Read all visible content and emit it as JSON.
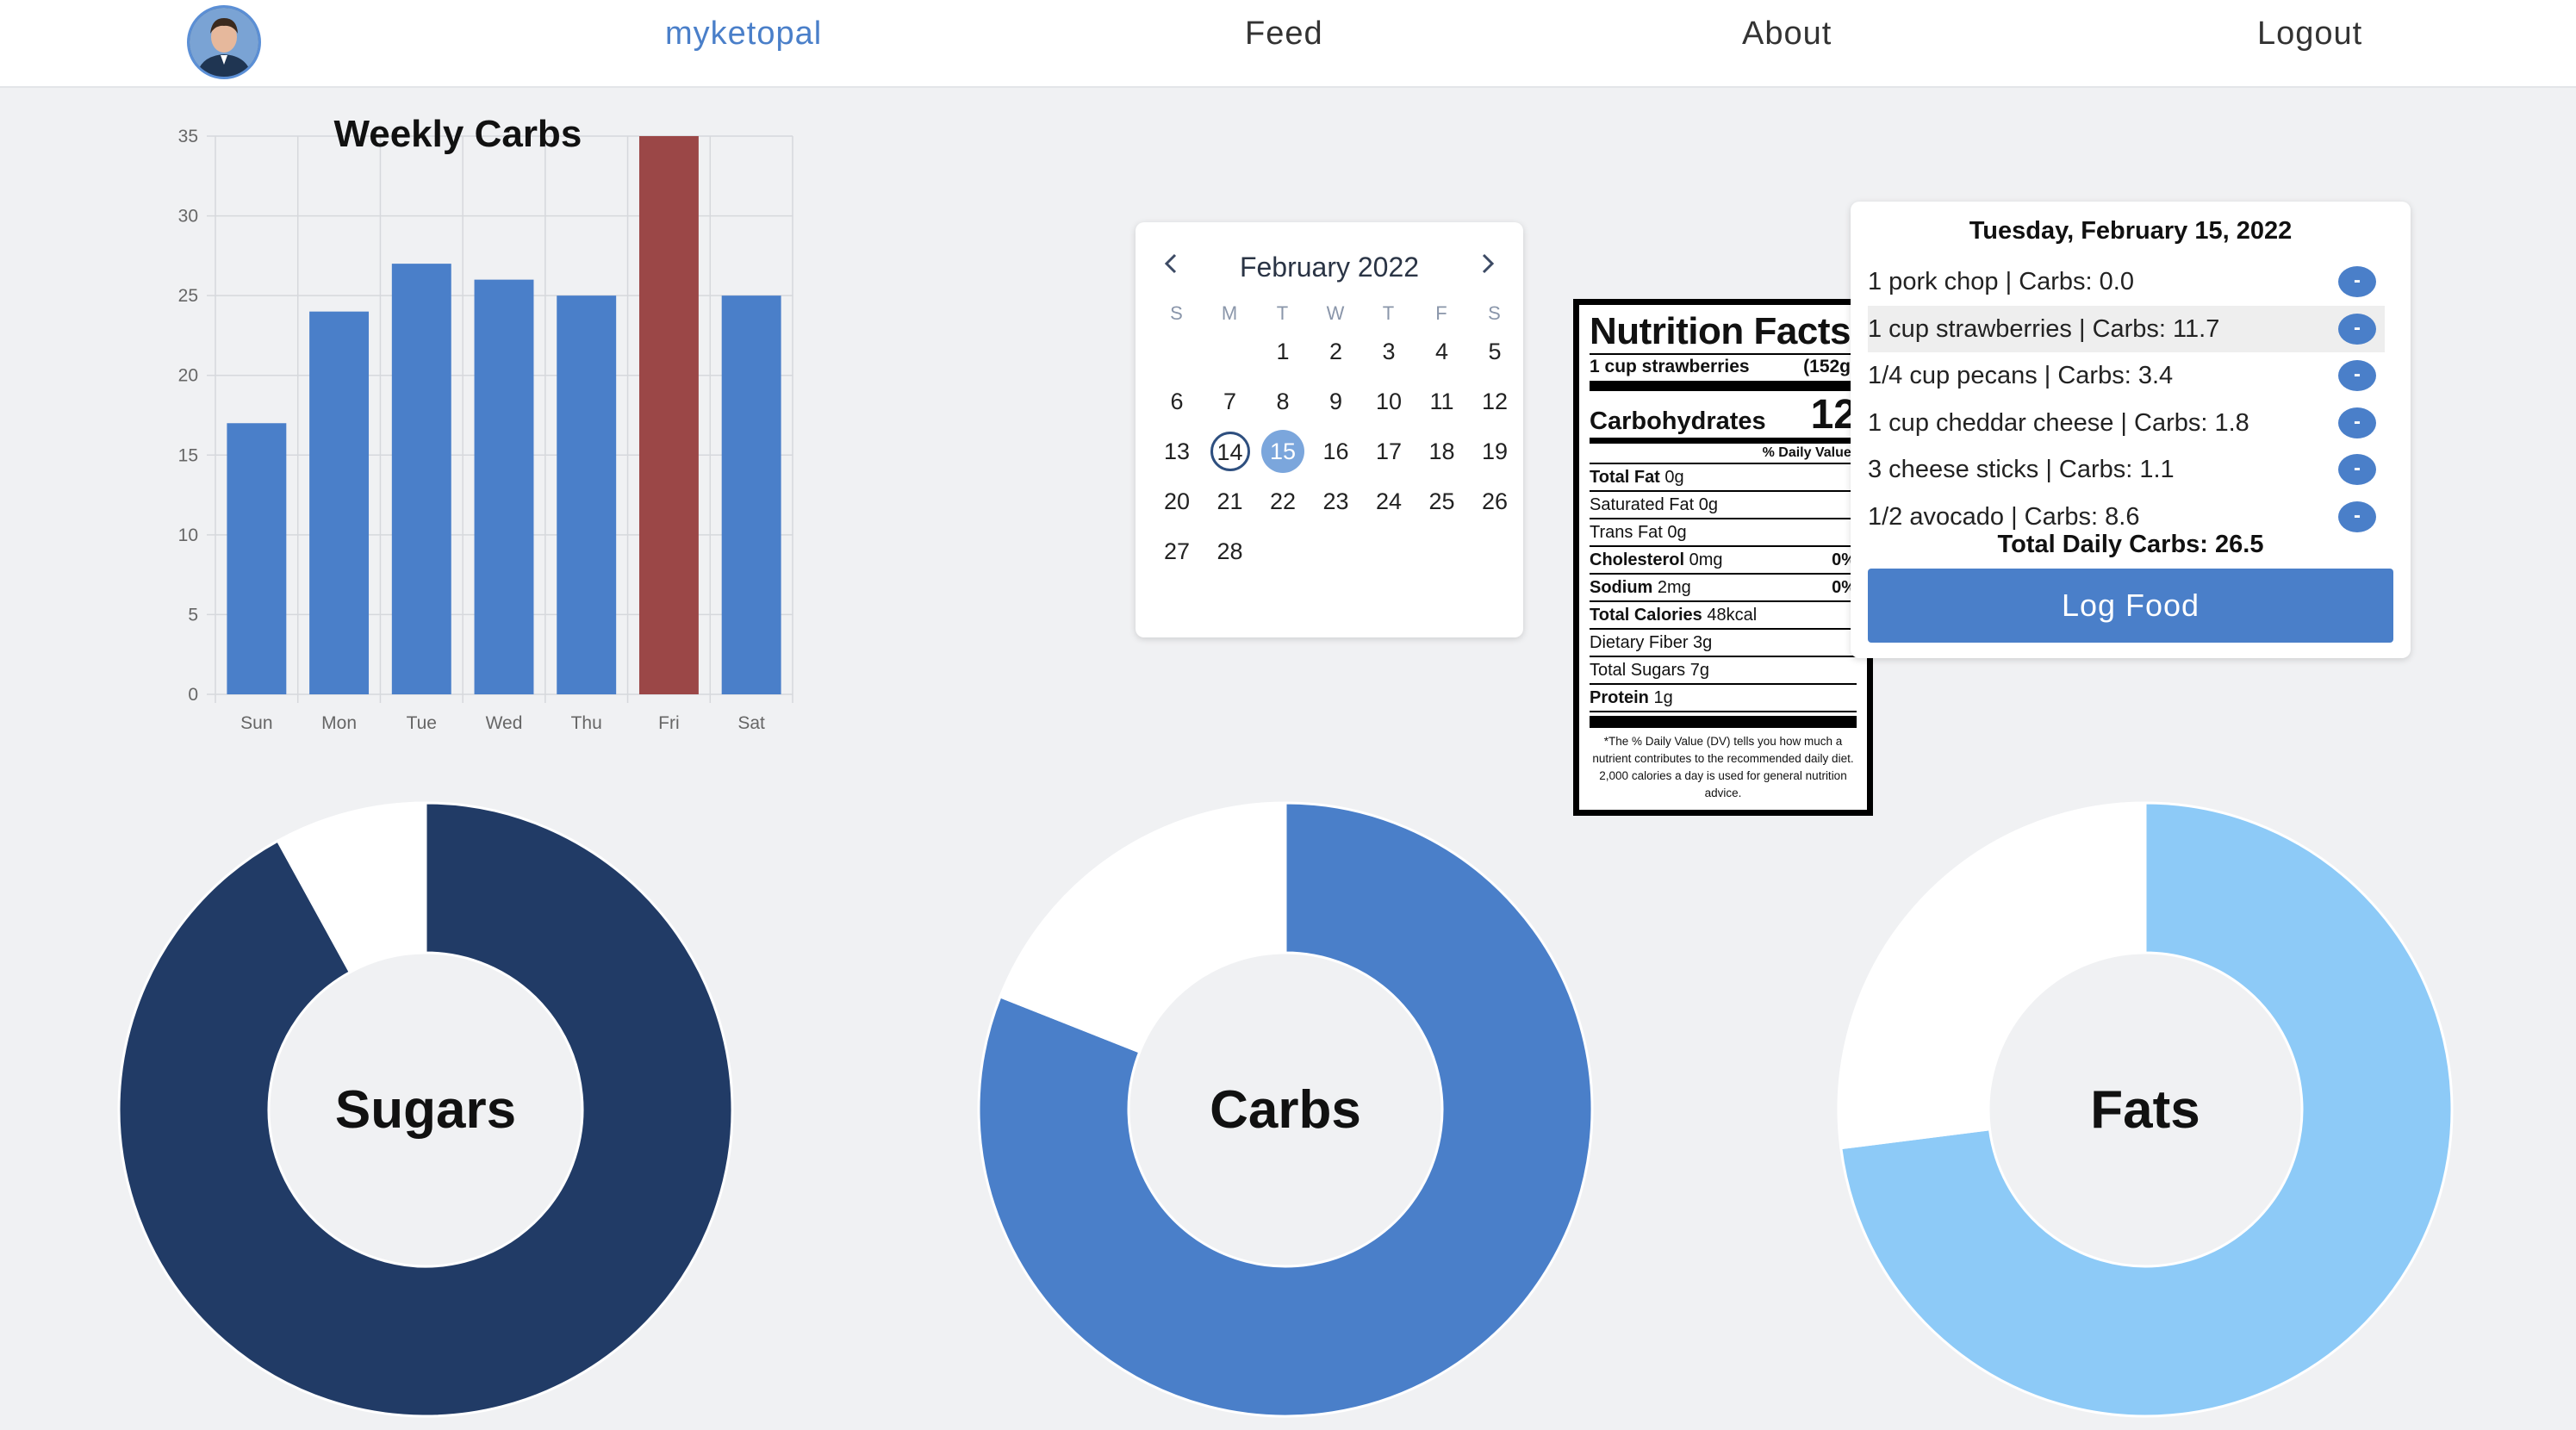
{
  "nav": {
    "brand": "myketopal",
    "links": [
      "Feed",
      "About",
      "Logout"
    ],
    "brand_color": "#4a7fc9"
  },
  "chart_data": [
    {
      "type": "bar",
      "title": "Weekly Carbs",
      "categories": [
        "Sun",
        "Mon",
        "Tue",
        "Wed",
        "Thu",
        "Fri",
        "Sat"
      ],
      "values": [
        17,
        24,
        27,
        26,
        25,
        35,
        25
      ],
      "ylim": [
        0,
        35
      ],
      "yticks": [
        0,
        5,
        10,
        15,
        20,
        25,
        30,
        35
      ],
      "grid": true,
      "colors": [
        "#4a7fc9",
        "#4a7fc9",
        "#4a7fc9",
        "#4a7fc9",
        "#4a7fc9",
        "#9b4747",
        "#4a7fc9"
      ]
    },
    {
      "type": "pie",
      "label": "Sugars",
      "values": [
        0.92,
        0.08
      ],
      "colors": [
        "#213b66",
        "#ffffff"
      ]
    },
    {
      "type": "pie",
      "label": "Carbs",
      "values": [
        0.81,
        0.19
      ],
      "colors": [
        "#4a7fc9",
        "#ffffff"
      ]
    },
    {
      "type": "pie",
      "label": "Fats",
      "values": [
        0.73,
        0.27
      ],
      "colors": [
        "#8dcaf7",
        "#ffffff"
      ]
    }
  ],
  "calendar": {
    "title": "February 2022",
    "prev_icon": "chevron-left-icon",
    "next_icon": "chevron-right-icon",
    "weekdays": [
      "S",
      "M",
      "T",
      "W",
      "T",
      "F",
      "S"
    ],
    "first_weekday": 2,
    "days_in_month": 28,
    "today": 14,
    "selected": 15
  },
  "nutrition": {
    "title": "Nutrition Facts",
    "serving": "1 cup strawberries",
    "serving_weight": "(152g)",
    "carb_label": "Carbohydrates",
    "carb_value": "12",
    "dv_label": "% Daily Value*",
    "rows": [
      {
        "label": "Total Fat",
        "value": "0g",
        "bold": true,
        "pct": ""
      },
      {
        "label": "Saturated Fat",
        "value": "0g",
        "bold": false,
        "pct": ""
      },
      {
        "label": "Trans Fat",
        "value": "0g",
        "bold": false,
        "pct": ""
      },
      {
        "label": "Cholesterol",
        "value": "0mg",
        "bold": true,
        "pct": "0%"
      },
      {
        "label": "Sodium",
        "value": "2mg",
        "bold": true,
        "pct": "0%"
      },
      {
        "label": "Total Calories",
        "value": "48kcal",
        "bold": true,
        "pct": ""
      },
      {
        "label": "Dietary Fiber",
        "value": "3g",
        "bold": false,
        "pct": ""
      },
      {
        "label": "Total Sugars",
        "value": "7g",
        "bold": false,
        "pct": ""
      },
      {
        "label": "Protein",
        "value": "1g",
        "bold": true,
        "pct": ""
      }
    ],
    "footnote": "*The % Daily Value (DV) tells you how much a nutrient contributes to the recommended daily diet. 2,000 calories a day is used for general nutrition advice."
  },
  "log": {
    "date": "Tuesday, February 15, 2022",
    "items": [
      {
        "text": "1 pork chop | Carbs: 0.0"
      },
      {
        "text": "1 cup strawberries | Carbs: 11.7"
      },
      {
        "text": "1/4 cup pecans | Carbs: 3.4"
      },
      {
        "text": "1 cup cheddar cheese | Carbs: 1.8"
      },
      {
        "text": "3 cheese sticks | Carbs: 1.1"
      },
      {
        "text": "1/2 avocado | Carbs: 8.6"
      }
    ],
    "highlighted_index": 1,
    "remove_label": "-",
    "total": "Total Daily Carbs: 26.5",
    "button": "Log Food"
  }
}
